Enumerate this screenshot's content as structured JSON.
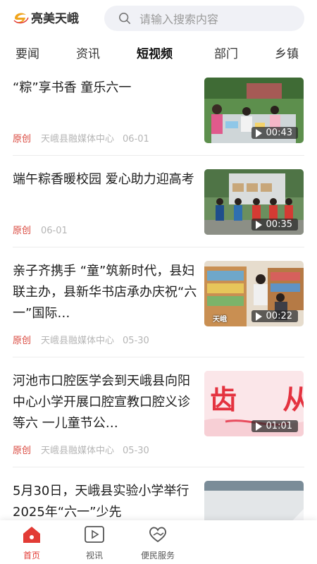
{
  "header": {
    "logo_text": "亮美天峨",
    "search_placeholder": "请输入搜索内容"
  },
  "tabs": [
    {
      "label": "要闻",
      "active": false
    },
    {
      "label": "资讯",
      "active": false
    },
    {
      "label": "短视频",
      "active": true
    },
    {
      "label": "部门",
      "active": false
    },
    {
      "label": "乡镇",
      "active": false
    }
  ],
  "items": [
    {
      "title": "“粽”享书香 童乐六一",
      "tag": "原创",
      "source": "天峨县融媒体中心",
      "date": "06-01",
      "duration": "00:43"
    },
    {
      "title": "端午粽香暖校园 爱心助力迎高考",
      "tag": "原创",
      "source": "",
      "date": "06-01",
      "duration": "00:35"
    },
    {
      "title": "亲子齐携手 “童”筑新时代，县妇联主办，县新华书店承办庆祝“六一”国际…",
      "tag": "原创",
      "source": "天峨县融媒体中心",
      "date": "05-30",
      "duration": "00:22",
      "thumb_caption": "天峨"
    },
    {
      "title": "河池市口腔医学会到天峨县向阳中心小学开展口腔宣教口腔义诊等六 一儿童节公…",
      "tag": "原创",
      "source": "天峨县融媒体中心",
      "date": "05-30",
      "duration": "01:01",
      "thumb_caption": "齿 从"
    },
    {
      "title": "5月30日，天峨县实验小学举行2025年“六一”少先",
      "tag": "",
      "source": "",
      "date": "",
      "duration": ""
    }
  ],
  "bottom_nav": [
    {
      "label": "首页",
      "icon": "home-icon",
      "active": true
    },
    {
      "label": "视讯",
      "icon": "video-icon",
      "active": false
    },
    {
      "label": "便民服务",
      "icon": "heart-hand-icon",
      "active": false
    }
  ],
  "colors": {
    "accent": "#e23b35",
    "tag": "#d9463c",
    "meta": "#b5b5b5"
  }
}
